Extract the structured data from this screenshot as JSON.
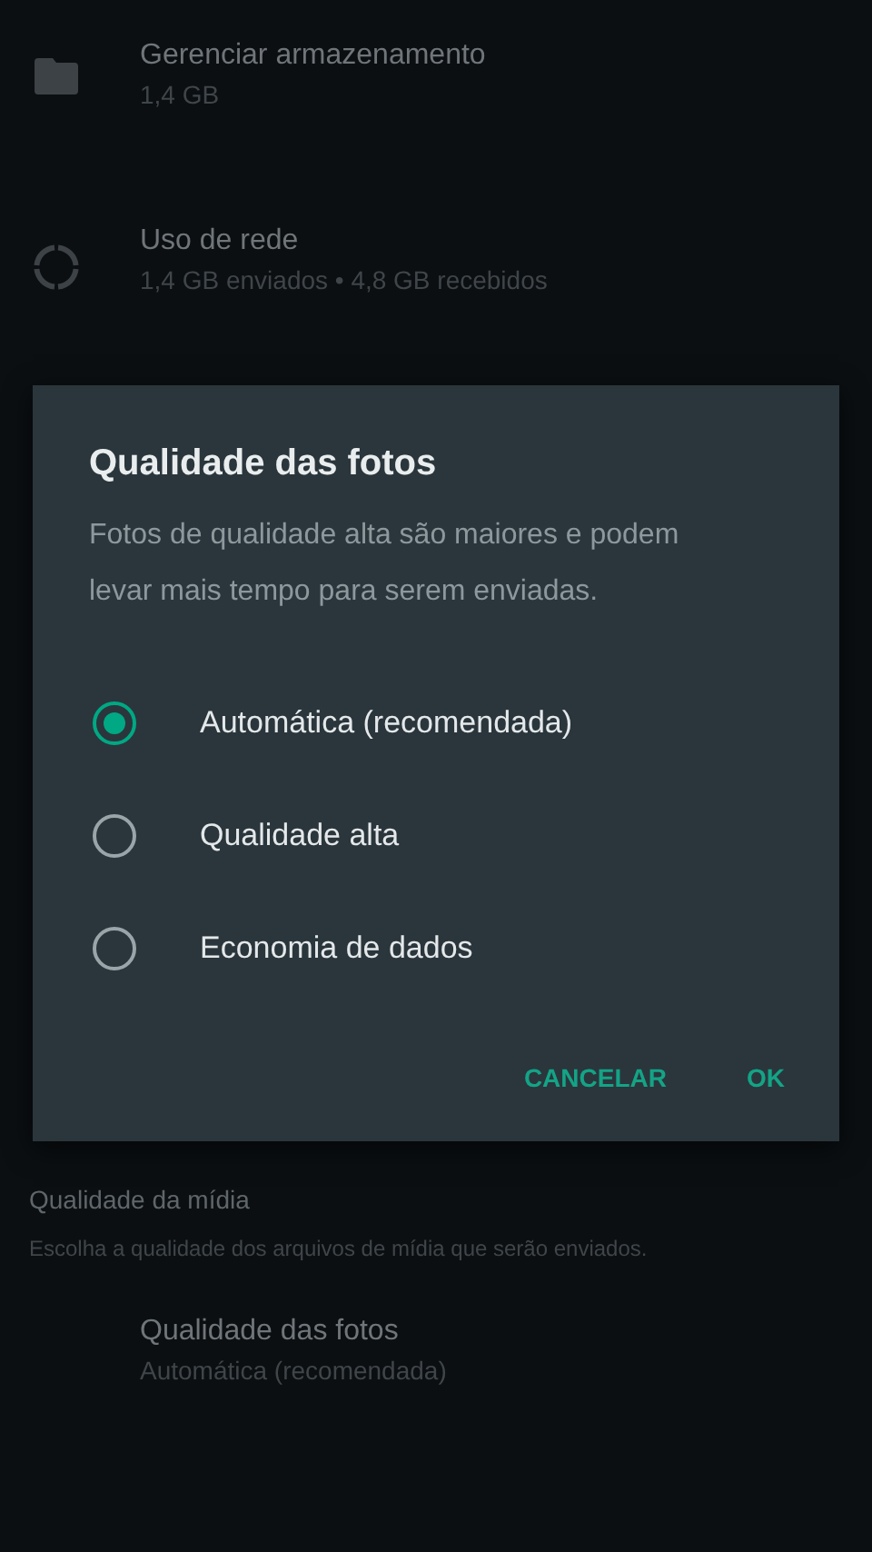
{
  "settings": [
    {
      "kind": "storage",
      "title": "Gerenciar armazenamento",
      "subtitle": "1,4 GB"
    },
    {
      "kind": "network",
      "title": "Uso de rede",
      "subtitle": "1,4 GB enviados • 4,8 GB recebidos"
    }
  ],
  "media_section": {
    "header": "Qualidade da mídia",
    "description": "Escolha a qualidade dos arquivos de mídia que serão enviados.",
    "items": [
      {
        "title": "Qualidade das fotos",
        "subtitle": "Automática (recomendada)"
      }
    ]
  },
  "dialog": {
    "title": "Qualidade das fotos",
    "message": "Fotos de qualidade alta são maiores e podem levar mais tempo para serem enviadas.",
    "options": [
      {
        "label": "Automática (recomendada)",
        "selected": true
      },
      {
        "label": "Qualidade alta",
        "selected": false
      },
      {
        "label": "Economia de dados",
        "selected": false
      }
    ],
    "buttons": [
      "CANCELAR",
      "OK"
    ]
  }
}
